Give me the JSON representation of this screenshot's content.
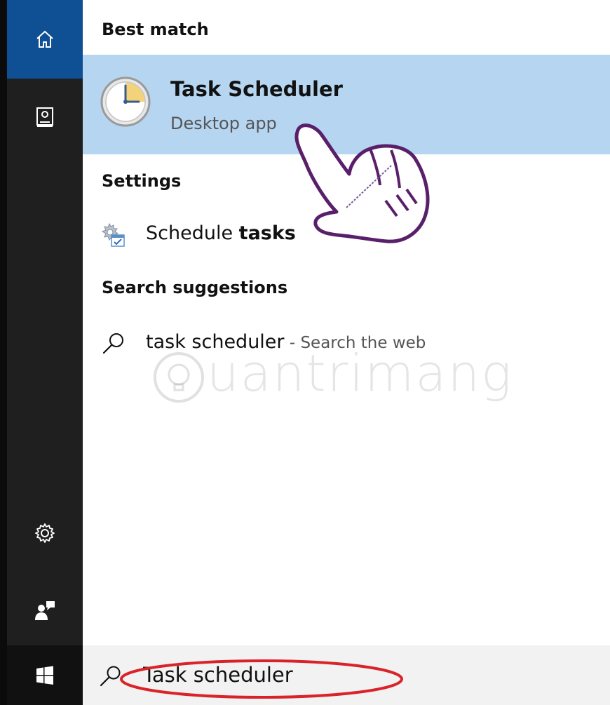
{
  "sidebar": {
    "home_icon": "home-icon",
    "notebook_icon": "notebook-icon",
    "settings_icon": "gear-icon",
    "feedback_icon": "feedback-icon",
    "start_icon": "windows-logo-icon"
  },
  "results": {
    "best_match_header": "Best match",
    "best_match": {
      "title": "Task Scheduler",
      "subtitle": "Desktop app",
      "icon": "clock-icon"
    },
    "settings_header": "Settings",
    "settings_item": {
      "label_prefix": "Schedule ",
      "label_bold": "tasks",
      "icon": "settings-gear-calendar-icon"
    },
    "suggestions_header": "Search suggestions",
    "suggestion": {
      "query": "task scheduler",
      "separator": " - ",
      "hint": "Search the web",
      "icon": "search-icon"
    }
  },
  "watermark": "uantrimang",
  "search": {
    "value": "Task scheduler",
    "icon": "search-icon"
  },
  "colors": {
    "sidebar_bg": "#1f1f1f",
    "home_active": "#0f4f94",
    "highlight": "#b5d5f1",
    "search_bg": "#f2f2f2",
    "annotation_red": "#d9232a",
    "annotation_purple": "#5a1f6a"
  }
}
